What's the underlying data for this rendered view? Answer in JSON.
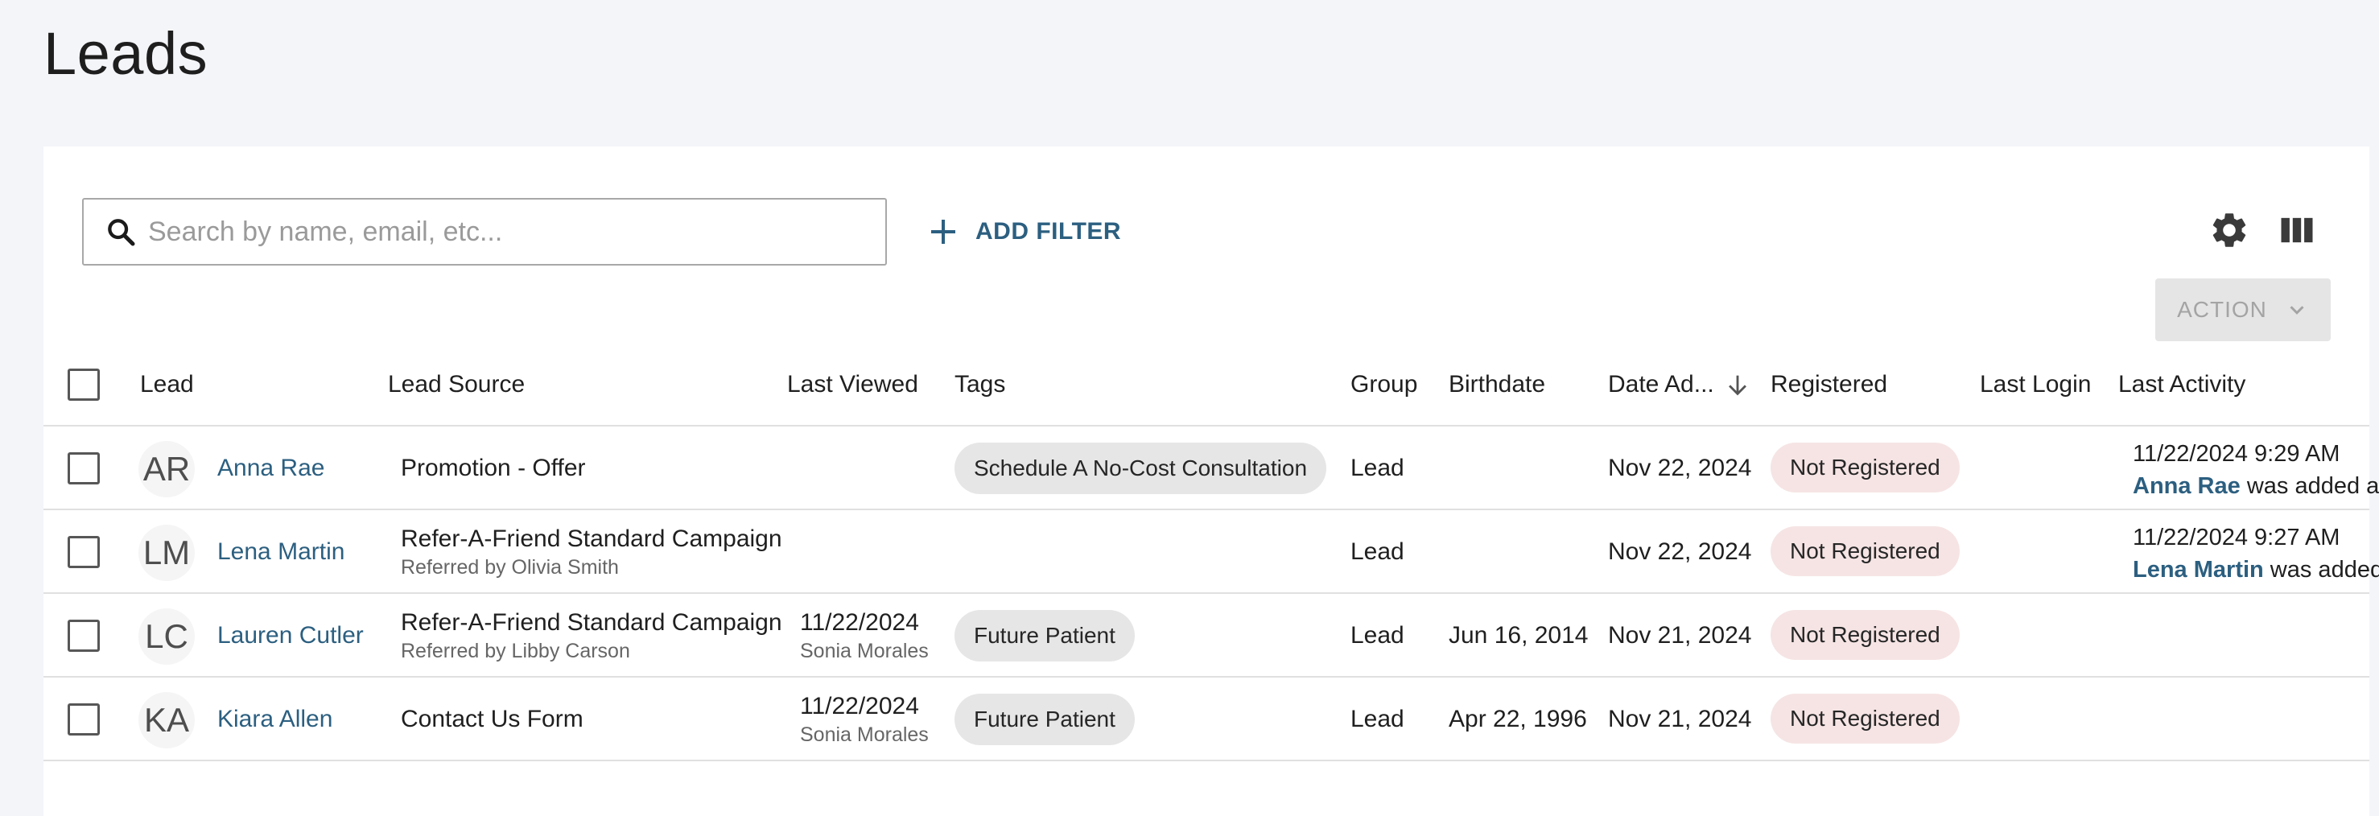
{
  "page": {
    "title": "Leads"
  },
  "toolbar": {
    "search_placeholder": "Search by name, email, etc...",
    "add_filter_label": "ADD FILTER",
    "action_label": "ACTION"
  },
  "table": {
    "headers": {
      "lead": "Lead",
      "lead_source": "Lead Source",
      "last_viewed": "Last Viewed",
      "tags": "Tags",
      "group": "Group",
      "birthdate": "Birthdate",
      "date_added": "Date Ad...",
      "registered": "Registered",
      "last_login": "Last Login",
      "last_activity": "Last Activity"
    },
    "rows": [
      {
        "initials": "AR",
        "name": "Anna Rae",
        "source": "Promotion - Offer",
        "source_sub": "",
        "last_viewed": "",
        "last_viewed_by": "",
        "tag": "Schedule A No-Cost Consultation",
        "group": "Lead",
        "birthdate": "",
        "date_added": "Nov 22, 2024",
        "registered": "Not Registered",
        "last_login": "",
        "activity_time": "11/22/2024 9:29 AM",
        "activity_name": "Anna Rae",
        "activity_text": " was added as"
      },
      {
        "initials": "LM",
        "name": "Lena Martin",
        "source": "Refer-A-Friend Standard Campaign",
        "source_sub": "Referred by Olivia Smith",
        "last_viewed": "",
        "last_viewed_by": "",
        "tag": "",
        "group": "Lead",
        "birthdate": "",
        "date_added": "Nov 22, 2024",
        "registered": "Not Registered",
        "last_login": "",
        "activity_time": "11/22/2024 9:27 AM",
        "activity_name": "Lena Martin",
        "activity_text": " was added"
      },
      {
        "initials": "LC",
        "name": "Lauren Cutler",
        "source": "Refer-A-Friend Standard Campaign",
        "source_sub": "Referred by Libby Carson",
        "last_viewed": "11/22/2024",
        "last_viewed_by": "Sonia Morales",
        "tag": "Future Patient",
        "group": "Lead",
        "birthdate": "Jun 16, 2014",
        "date_added": "Nov 21, 2024",
        "registered": "Not Registered",
        "last_login": "",
        "activity_time": "",
        "activity_name": "",
        "activity_text": ""
      },
      {
        "initials": "KA",
        "name": "Kiara Allen",
        "source": "Contact Us Form",
        "source_sub": "",
        "last_viewed": "11/22/2024",
        "last_viewed_by": "Sonia Morales",
        "tag": "Future Patient",
        "group": "Lead",
        "birthdate": "Apr 22, 1996",
        "date_added": "Nov 21, 2024",
        "registered": "Not Registered",
        "last_login": "",
        "activity_time": "",
        "activity_name": "",
        "activity_text": ""
      }
    ]
  },
  "icons": {
    "search": "search-icon",
    "add": "plus-icon",
    "settings": "gear-icon",
    "columns": "columns-icon",
    "chevron": "chevron-down-icon",
    "sort": "arrow-down-icon"
  },
  "colors": {
    "accent": "#2c5f80",
    "badge_bg": "#f6e4e4",
    "tag_bg": "#e6e6e6",
    "page_bg": "#f4f5f9"
  }
}
